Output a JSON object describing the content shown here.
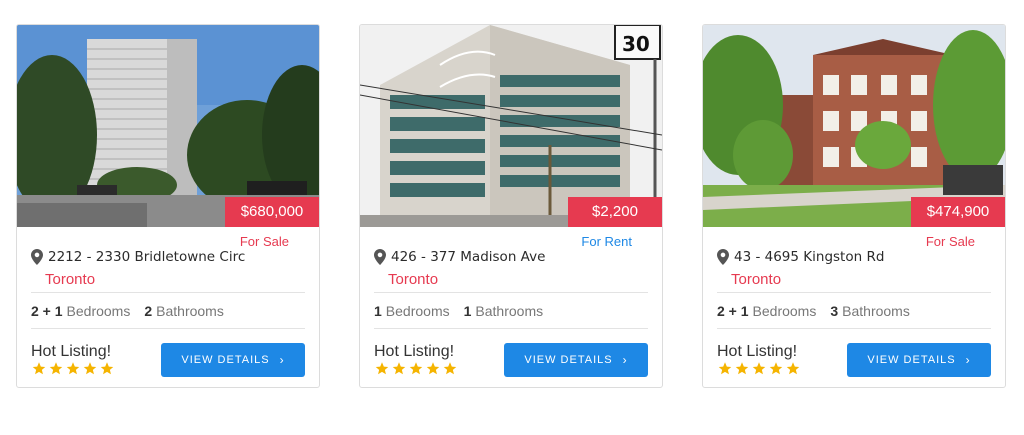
{
  "listings": [
    {
      "price": "$680,000",
      "status": "For Sale",
      "status_color": "#e63a50",
      "address": "2212 - 2330 Bridletowne Circ",
      "city": "Toronto",
      "bedrooms": "2 + 1",
      "bedrooms_label": "Bedrooms",
      "bathrooms": "2",
      "bathrooms_label": "Bathrooms",
      "tag": "Hot Listing!",
      "rating": 5,
      "button_label": "VIEW DETAILS"
    },
    {
      "price": "$2,200",
      "status": "For Rent",
      "status_color": "#1e88e5",
      "address": "426 - 377 Madison Ave",
      "city": "Toronto",
      "bedrooms": "1",
      "bedrooms_label": "Bedrooms",
      "bathrooms": "1",
      "bathrooms_label": "Bathrooms",
      "tag": "Hot Listing!",
      "rating": 5,
      "button_label": "VIEW DETAILS"
    },
    {
      "price": "$474,900",
      "status": "For Sale",
      "status_color": "#e63a50",
      "address": "43 - 4695 Kingston Rd",
      "city": "Toronto",
      "bedrooms": "2 + 1",
      "bedrooms_label": "Bedrooms",
      "bathrooms": "3",
      "bathrooms_label": "Bathrooms",
      "tag": "Hot Listing!",
      "rating": 5,
      "button_label": "VIEW DETAILS"
    }
  ],
  "colors": {
    "accent_red": "#e63a50",
    "accent_blue": "#1e88e5",
    "star": "#f5b400"
  },
  "icons": {
    "location": "map-pin-icon",
    "chevron": "chevron-right-icon",
    "star": "star-icon"
  }
}
